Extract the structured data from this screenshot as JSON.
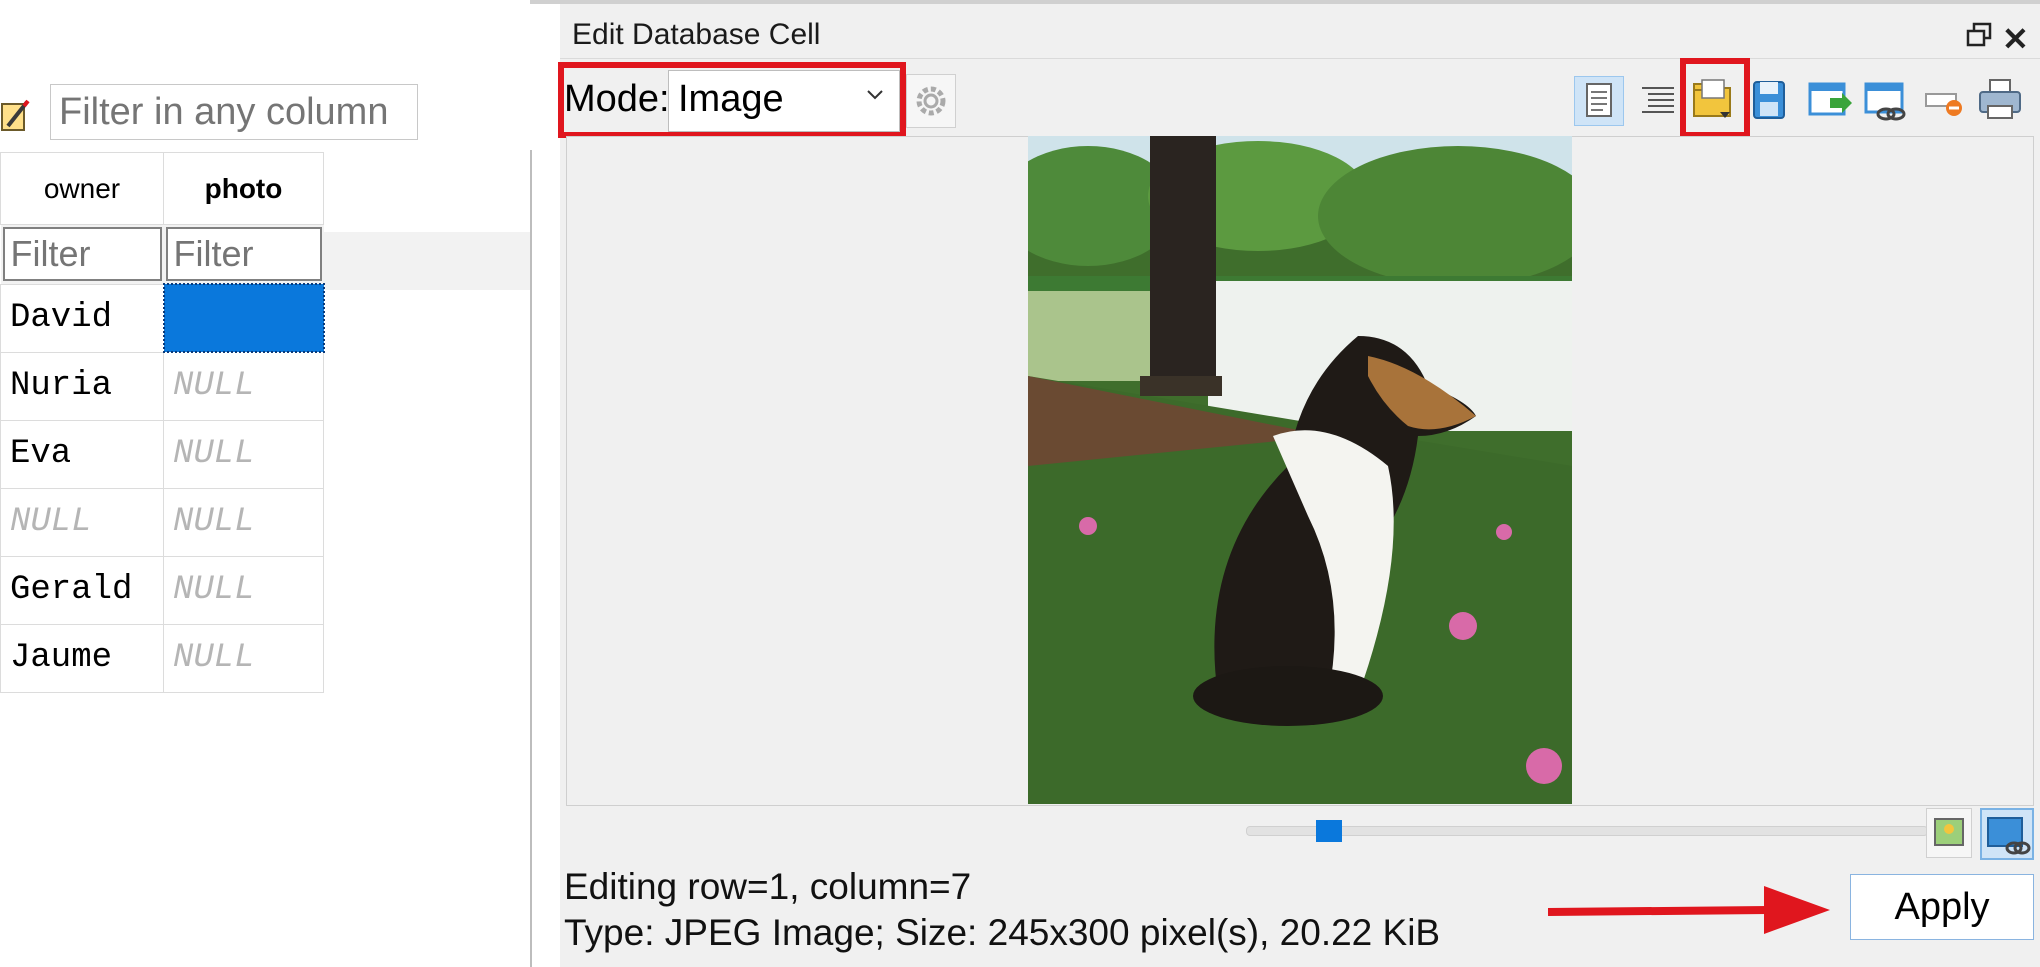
{
  "left": {
    "filter_any_placeholder": "Filter in any column",
    "columns": [
      "owner",
      "photo"
    ],
    "filter_placeholder": "Filter",
    "rows": [
      {
        "owner": "David",
        "photo": ""
      },
      {
        "owner": "Nuria",
        "photo": "NULL"
      },
      {
        "owner": "Eva",
        "photo": "NULL"
      },
      {
        "owner": "NULL",
        "photo": "NULL"
      },
      {
        "owner": "Gerald",
        "photo": "NULL"
      },
      {
        "owner": "Jaume",
        "photo": "NULL"
      }
    ]
  },
  "editor": {
    "title": "Edit Database Cell",
    "mode_label": "Mode:",
    "mode_value": "Image",
    "status_line1": "Editing row=1, column=7",
    "status_line2": "Type: JPEG Image; Size: 245x300 pixel(s), 20.22 KiB",
    "apply_label": "Apply"
  },
  "colors": {
    "highlight": "#e0161e",
    "selection": "#0a78dc"
  },
  "icons": [
    "edit-icon",
    "float-icon",
    "close-icon",
    "chevron-down-icon",
    "gear-icon",
    "text-mode-icon",
    "format-icon",
    "import-icon",
    "export-icon",
    "export-file-icon",
    "link-icon",
    "set-null-icon",
    "print-icon",
    "fit-image-icon",
    "zoom-image-icon"
  ]
}
